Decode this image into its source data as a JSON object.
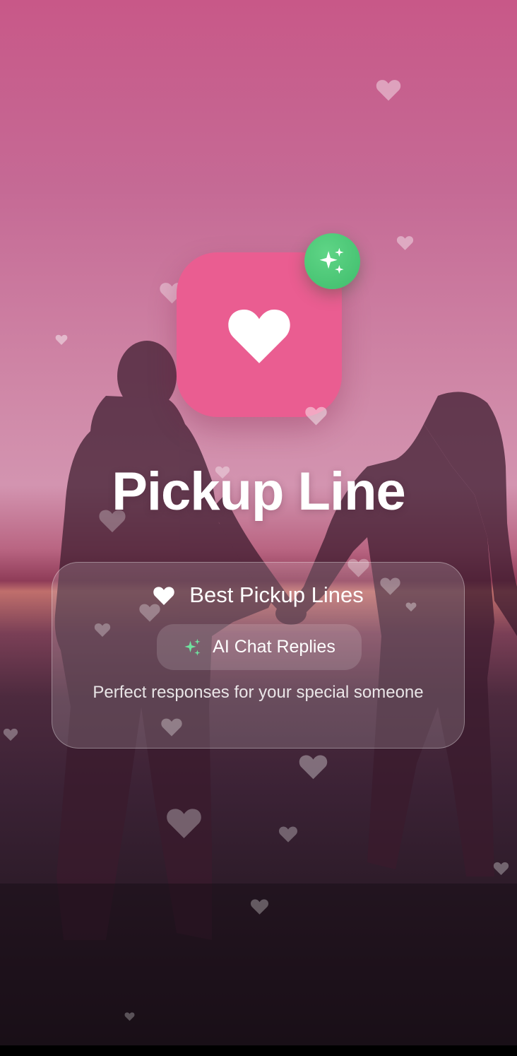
{
  "app": {
    "title": "Pickup Line"
  },
  "card": {
    "headline": "Best Pickup Lines",
    "headline_icon": "heart-icon",
    "ai_pill_label": "AI Chat Replies",
    "ai_pill_icon": "sparkles-icon",
    "tagline": "Perfect responses for your special someone"
  },
  "icons": {
    "app_icon": "heart-icon",
    "badge_icon": "sparkles-icon"
  },
  "colors": {
    "app_icon_bg": "#ea5d91",
    "badge_bg": "#4cc776",
    "sparkle_accent": "#6fe3a0",
    "text": "#ffffff"
  }
}
